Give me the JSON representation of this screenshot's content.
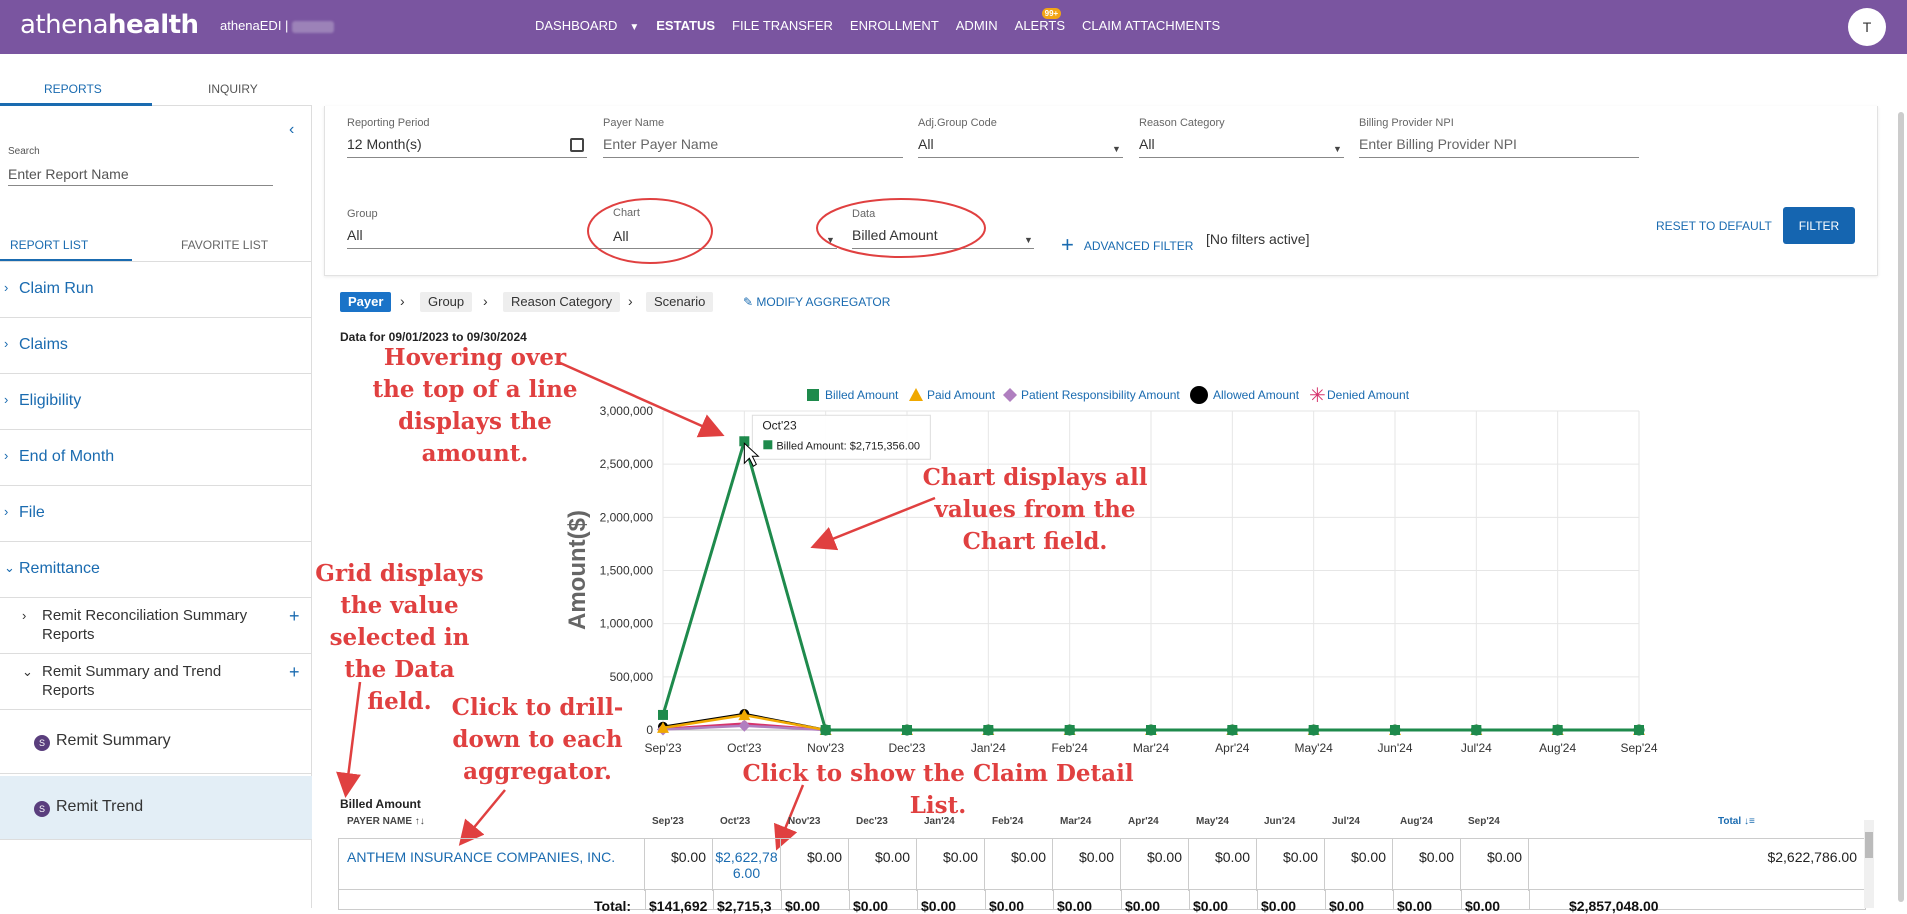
{
  "brand": {
    "logo_part1": "athena",
    "logo_part2": "health",
    "product": "athenaEDI |"
  },
  "nav": {
    "items": [
      "DASHBOARD",
      "ESTATUS",
      "FILE TRANSFER",
      "ENROLLMENT",
      "ADMIN",
      "ALERTS",
      "CLAIM ATTACHMENTS"
    ],
    "alerts_badge": "99+",
    "avatar_initial": "T"
  },
  "left_tabs": {
    "reports": "REPORTS",
    "inquiry": "INQUIRY"
  },
  "sidebar": {
    "search_label": "Search",
    "search_placeholder": "Enter Report Name",
    "list_tabs": {
      "report_list": "REPORT LIST",
      "favorite_list": "FAVORITE LIST"
    },
    "categories": [
      "Claim Run",
      "Claims",
      "Eligibility",
      "End of Month",
      "File",
      "Remittance"
    ],
    "subcategories": [
      "Remit Reconciliation Summary Reports",
      "Remit Summary and Trend Reports"
    ],
    "reports": [
      {
        "icon": "S",
        "label": "Remit Summary"
      },
      {
        "icon": "S",
        "label": "Remit Trend"
      }
    ]
  },
  "filters": {
    "reporting_period": {
      "label": "Reporting Period",
      "value": "12 Month(s)"
    },
    "payer_name": {
      "label": "Payer Name",
      "placeholder": "Enter Payer Name"
    },
    "adj_group_code": {
      "label": "Adj.Group Code",
      "value": "All"
    },
    "reason_category": {
      "label": "Reason Category",
      "value": "All"
    },
    "billing_provider_npi": {
      "label": "Billing Provider NPI",
      "placeholder": "Enter Billing Provider NPI"
    },
    "group": {
      "label": "Group",
      "value": "All"
    },
    "chart": {
      "label": "Chart",
      "value": "All"
    },
    "data": {
      "label": "Data",
      "value": "Billed Amount"
    },
    "advanced_filter": "ADVANCED FILTER",
    "no_filters": "[No filters active]",
    "reset": "RESET TO DEFAULT",
    "filter_button": "FILTER"
  },
  "breadcrumbs": [
    "Payer",
    "Group",
    "Reason Category",
    "Scenario"
  ],
  "modify_aggregator": "MODIFY AGGREGATOR",
  "date_range": "Data for 09/01/2023 to 09/30/2024",
  "chart_data": {
    "type": "line",
    "ylabel": "Amount($)",
    "categories": [
      "Sep'23",
      "Oct'23",
      "Nov'23",
      "Dec'23",
      "Jan'24",
      "Feb'24",
      "Mar'24",
      "Apr'24",
      "May'24",
      "Jun'24",
      "Jul'24",
      "Aug'24",
      "Sep'24"
    ],
    "ylim": [
      0,
      3000000
    ],
    "yticks": [
      "0",
      "500,000",
      "1,000,000",
      "1,500,000",
      "2,000,000",
      "2,500,000",
      "3,000,000"
    ],
    "legend_position": "top",
    "series": [
      {
        "name": "Billed Amount",
        "color": "#1e8a4c",
        "marker": "square",
        "values": [
          141692,
          2715356,
          0,
          0,
          0,
          0,
          0,
          0,
          0,
          0,
          0,
          0,
          0
        ]
      },
      {
        "name": "Paid Amount",
        "color": "#f0a800",
        "marker": "triangle",
        "values": [
          20000,
          140000,
          0,
          0,
          0,
          0,
          0,
          0,
          0,
          0,
          0,
          0,
          0
        ]
      },
      {
        "name": "Patient Responsibility Amount",
        "color": "#b07fc0",
        "marker": "diamond",
        "values": [
          5000,
          40000,
          0,
          0,
          0,
          0,
          0,
          0,
          0,
          0,
          0,
          0,
          0
        ]
      },
      {
        "name": "Allowed Amount",
        "color": "#000000",
        "marker": "circle",
        "values": [
          30000,
          150000,
          0,
          0,
          0,
          0,
          0,
          0,
          0,
          0,
          0,
          0,
          0
        ]
      },
      {
        "name": "Denied Amount",
        "color": "#d6336c",
        "marker": "star",
        "values": [
          10000,
          60000,
          0,
          0,
          0,
          0,
          0,
          0,
          0,
          0,
          0,
          0,
          0
        ]
      }
    ],
    "tooltip": {
      "title": "Oct'23",
      "text": "Billed Amount: $2,715,356.00"
    }
  },
  "annotations": {
    "hover": "Hovering over the top of a line displays the amount.",
    "chart_field": "Chart displays all values from the Chart field.",
    "grid": "Grid displays the value selected in the Data field.",
    "drill": "Click to drill-down to each aggregator.",
    "claim_detail": "Click to show the Claim Detail List."
  },
  "grid": {
    "title": "Billed Amount",
    "first_col": "PAYER NAME",
    "months": [
      "Sep'23",
      "Oct'23",
      "Nov'23",
      "Dec'23",
      "Jan'24",
      "Feb'24",
      "Mar'24",
      "Apr'24",
      "May'24",
      "Jun'24",
      "Jul'24",
      "Aug'24",
      "Sep'24"
    ],
    "total_col": "Total",
    "row": {
      "payer": "ANTHEM INSURANCE COMPANIES, INC.",
      "values": [
        "$0.00",
        "$2,622,786.00",
        "$0.00",
        "$0.00",
        "$0.00",
        "$0.00",
        "$0.00",
        "$0.00",
        "$0.00",
        "$0.00",
        "$0.00",
        "$0.00",
        "$0.00"
      ],
      "total": "$2,622,786.00"
    },
    "totals": {
      "label": "Total:",
      "values": [
        "$141,692",
        "$2,715,3",
        "$0.00",
        "$0.00",
        "$0.00",
        "$0.00",
        "$0.00",
        "$0.00",
        "$0.00",
        "$0.00",
        "$0.00",
        "$0.00",
        "$0.00"
      ],
      "total": "$2,857,048.00"
    }
  }
}
